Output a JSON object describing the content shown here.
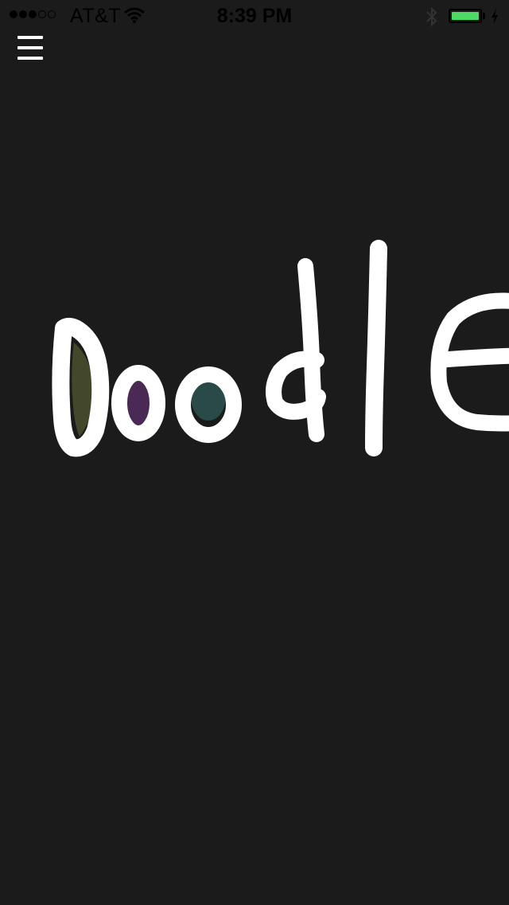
{
  "status_bar": {
    "carrier": "AT&T",
    "time": "8:39 PM",
    "signal_bars_filled": 3,
    "signal_bars_total": 5,
    "battery_level": 1.0,
    "battery_color": "#4cd964",
    "charging": true,
    "icons": [
      "signal-icon",
      "wifi-icon",
      "bluetooth-icon",
      "battery-icon",
      "charging-bolt-icon"
    ]
  },
  "toolbar": {
    "menu_icon": "hamburger-menu-icon"
  },
  "canvas": {
    "background": "#1b1b1b",
    "stroke_color": "#ffffff",
    "fill_colors": [
      "#43482a",
      "#4a2a55",
      "#2a4a4a"
    ]
  }
}
